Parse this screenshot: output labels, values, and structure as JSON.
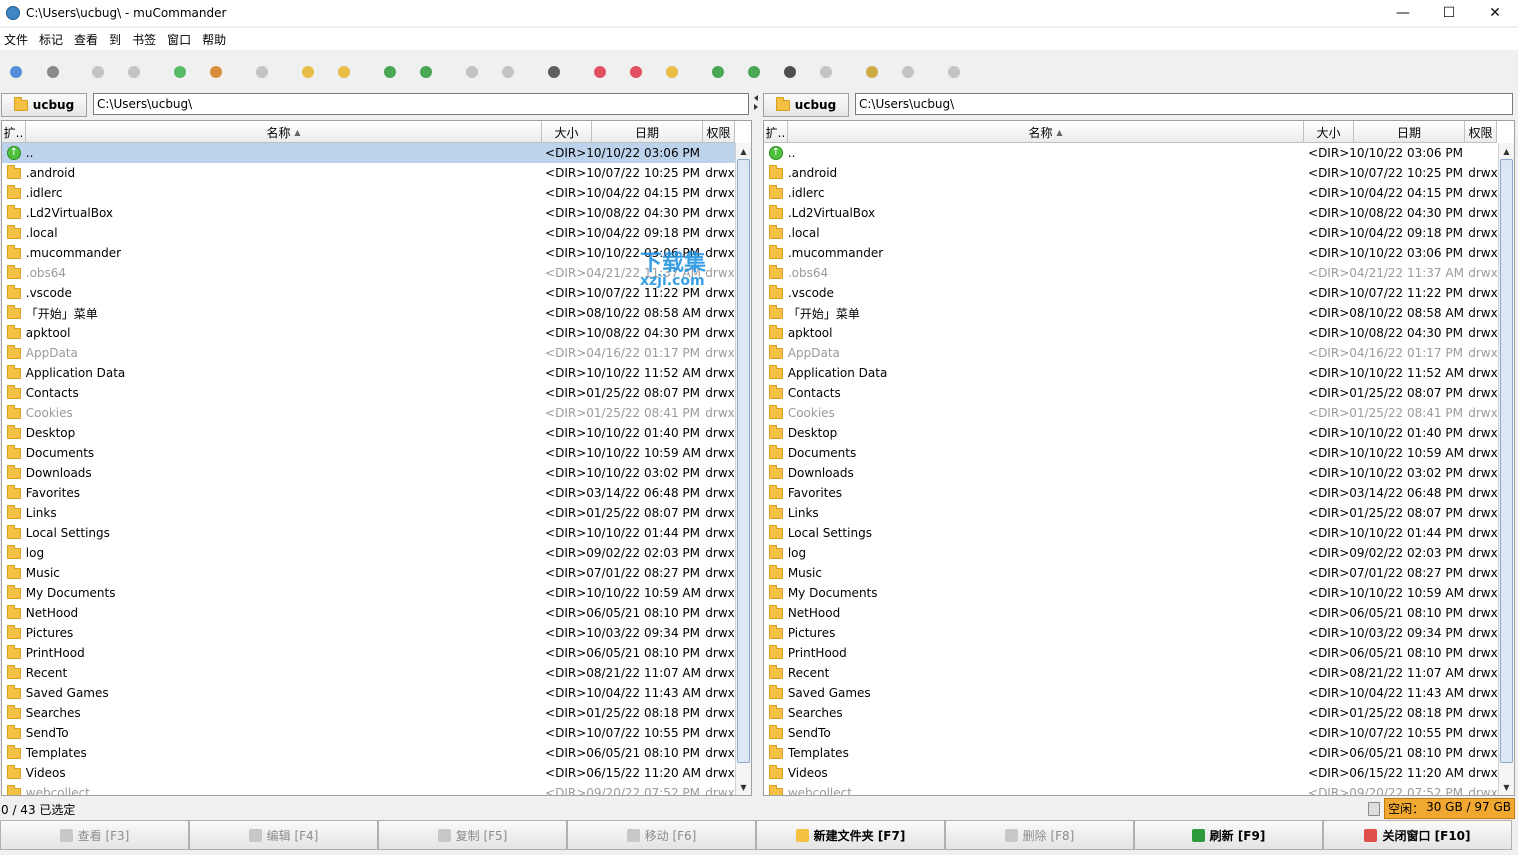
{
  "window": {
    "title": "C:\\Users\\ucbug\\ - muCommander"
  },
  "menu": [
    "文件",
    "标记",
    "查看",
    "到",
    "书签",
    "窗口",
    "帮助"
  ],
  "toolbar_icons": [
    "new-window-icon",
    "add-drive-icon",
    "back-icon",
    "forward-icon",
    "parent-folder-icon",
    "home-icon",
    "stop-icon",
    "new-folder-icon",
    "new-file-icon",
    "refresh-icon",
    "swap-panels-icon",
    "pack-icon",
    "unpack-icon",
    "compare-icon",
    "add-bookmark-icon",
    "edit-bookmarks-icon",
    "credentials-icon",
    "connect-server-icon",
    "browse-web-icon",
    "terminal-icon",
    "console-icon",
    "run-icon",
    "email-icon",
    "preferences-icon"
  ],
  "left": {
    "location_button": "ucbug",
    "path": "C:\\Users\\ucbug\\",
    "headers": {
      "ext": "扩..",
      "name": "名称",
      "size": "大小",
      "date": "日期",
      "perm": "权限"
    }
  },
  "right": {
    "location_button": "ucbug",
    "path": "C:\\Users\\ucbug\\",
    "headers": {
      "ext": "扩..",
      "name": "名称",
      "size": "大小",
      "date": "日期",
      "perm": "权限"
    }
  },
  "files_left": [
    {
      "name": "..",
      "size": "<DIR>",
      "date": "10/10/22 03:06 PM",
      "perm": "",
      "up": true,
      "sel": true
    },
    {
      "name": ".android",
      "size": "<DIR>",
      "date": "10/07/22 10:25 PM",
      "perm": "drwx"
    },
    {
      "name": ".idlerc",
      "size": "<DIR>",
      "date": "10/04/22 04:15 PM",
      "perm": "drwx"
    },
    {
      "name": ".Ld2VirtualBox",
      "size": "<DIR>",
      "date": "10/08/22 04:30 PM",
      "perm": "drwx"
    },
    {
      "name": ".local",
      "size": "<DIR>",
      "date": "10/04/22 09:18 PM",
      "perm": "drwx"
    },
    {
      "name": ".mucommander",
      "size": "<DIR>",
      "date": "10/10/22 03:06 PM",
      "perm": "drwx"
    },
    {
      "name": ".obs64",
      "size": "<DIR>",
      "date": "04/21/22 11:37 AM",
      "perm": "drwx",
      "hidden": true
    },
    {
      "name": ".vscode",
      "size": "<DIR>",
      "date": "10/07/22 11:22 PM",
      "perm": "drwx"
    },
    {
      "name": "「开始」菜单",
      "size": "<DIR>",
      "date": "08/10/22 08:58 AM",
      "perm": "drwx"
    },
    {
      "name": "apktool",
      "size": "<DIR>",
      "date": "10/08/22 04:30 PM",
      "perm": "drwx"
    },
    {
      "name": "AppData",
      "size": "<DIR>",
      "date": "04/16/22 01:17 PM",
      "perm": "drwx",
      "hidden": true
    },
    {
      "name": "Application Data",
      "size": "<DIR>",
      "date": "10/10/22 11:52 AM",
      "perm": "drwx"
    },
    {
      "name": "Contacts",
      "size": "<DIR>",
      "date": "01/25/22 08:07 PM",
      "perm": "drwx"
    },
    {
      "name": "Cookies",
      "size": "<DIR>",
      "date": "01/25/22 08:41 PM",
      "perm": "drwx",
      "hidden": true
    },
    {
      "name": "Desktop",
      "size": "<DIR>",
      "date": "10/10/22 01:40 PM",
      "perm": "drwx"
    },
    {
      "name": "Documents",
      "size": "<DIR>",
      "date": "10/10/22 10:59 AM",
      "perm": "drwx"
    },
    {
      "name": "Downloads",
      "size": "<DIR>",
      "date": "10/10/22 03:02 PM",
      "perm": "drwx"
    },
    {
      "name": "Favorites",
      "size": "<DIR>",
      "date": "03/14/22 06:48 PM",
      "perm": "drwx"
    },
    {
      "name": "Links",
      "size": "<DIR>",
      "date": "01/25/22 08:07 PM",
      "perm": "drwx"
    },
    {
      "name": "Local Settings",
      "size": "<DIR>",
      "date": "10/10/22 01:44 PM",
      "perm": "drwx"
    },
    {
      "name": "log",
      "size": "<DIR>",
      "date": "09/02/22 02:03 PM",
      "perm": "drwx"
    },
    {
      "name": "Music",
      "size": "<DIR>",
      "date": "07/01/22 08:27 PM",
      "perm": "drwx"
    },
    {
      "name": "My Documents",
      "size": "<DIR>",
      "date": "10/10/22 10:59 AM",
      "perm": "drwx"
    },
    {
      "name": "NetHood",
      "size": "<DIR>",
      "date": "06/05/21 08:10 PM",
      "perm": "drwx"
    },
    {
      "name": "Pictures",
      "size": "<DIR>",
      "date": "10/03/22 09:34 PM",
      "perm": "drwx"
    },
    {
      "name": "PrintHood",
      "size": "<DIR>",
      "date": "06/05/21 08:10 PM",
      "perm": "drwx"
    },
    {
      "name": "Recent",
      "size": "<DIR>",
      "date": "08/21/22 11:07 AM",
      "perm": "drwx"
    },
    {
      "name": "Saved Games",
      "size": "<DIR>",
      "date": "10/04/22 11:43 AM",
      "perm": "drwx"
    },
    {
      "name": "Searches",
      "size": "<DIR>",
      "date": "01/25/22 08:18 PM",
      "perm": "drwx"
    },
    {
      "name": "SendTo",
      "size": "<DIR>",
      "date": "10/07/22 10:55 PM",
      "perm": "drwx"
    },
    {
      "name": "Templates",
      "size": "<DIR>",
      "date": "06/05/21 08:10 PM",
      "perm": "drwx"
    },
    {
      "name": "Videos",
      "size": "<DIR>",
      "date": "06/15/22 11:20 AM",
      "perm": "drwx"
    },
    {
      "name": "webcollect",
      "size": "<DIR>",
      "date": "09/20/22 07:52 PM",
      "perm": "drwx",
      "hidden": true
    }
  ],
  "files_right": [
    {
      "name": "..",
      "size": "<DIR>",
      "date": "10/10/22 03:06 PM",
      "perm": "",
      "up": true
    },
    {
      "name": ".android",
      "size": "<DIR>",
      "date": "10/07/22 10:25 PM",
      "perm": "drwx"
    },
    {
      "name": ".idlerc",
      "size": "<DIR>",
      "date": "10/04/22 04:15 PM",
      "perm": "drwx"
    },
    {
      "name": ".Ld2VirtualBox",
      "size": "<DIR>",
      "date": "10/08/22 04:30 PM",
      "perm": "drwx"
    },
    {
      "name": ".local",
      "size": "<DIR>",
      "date": "10/04/22 09:18 PM",
      "perm": "drwx"
    },
    {
      "name": ".mucommander",
      "size": "<DIR>",
      "date": "10/10/22 03:06 PM",
      "perm": "drwx"
    },
    {
      "name": ".obs64",
      "size": "<DIR>",
      "date": "04/21/22 11:37 AM",
      "perm": "drwx",
      "hidden": true
    },
    {
      "name": ".vscode",
      "size": "<DIR>",
      "date": "10/07/22 11:22 PM",
      "perm": "drwx"
    },
    {
      "name": "「开始」菜单",
      "size": "<DIR>",
      "date": "08/10/22 08:58 AM",
      "perm": "drwx"
    },
    {
      "name": "apktool",
      "size": "<DIR>",
      "date": "10/08/22 04:30 PM",
      "perm": "drwx"
    },
    {
      "name": "AppData",
      "size": "<DIR>",
      "date": "04/16/22 01:17 PM",
      "perm": "drwx",
      "hidden": true
    },
    {
      "name": "Application Data",
      "size": "<DIR>",
      "date": "10/10/22 11:52 AM",
      "perm": "drwx"
    },
    {
      "name": "Contacts",
      "size": "<DIR>",
      "date": "01/25/22 08:07 PM",
      "perm": "drwx"
    },
    {
      "name": "Cookies",
      "size": "<DIR>",
      "date": "01/25/22 08:41 PM",
      "perm": "drwx",
      "hidden": true
    },
    {
      "name": "Desktop",
      "size": "<DIR>",
      "date": "10/10/22 01:40 PM",
      "perm": "drwx"
    },
    {
      "name": "Documents",
      "size": "<DIR>",
      "date": "10/10/22 10:59 AM",
      "perm": "drwx"
    },
    {
      "name": "Downloads",
      "size": "<DIR>",
      "date": "10/10/22 03:02 PM",
      "perm": "drwx"
    },
    {
      "name": "Favorites",
      "size": "<DIR>",
      "date": "03/14/22 06:48 PM",
      "perm": "drwx"
    },
    {
      "name": "Links",
      "size": "<DIR>",
      "date": "01/25/22 08:07 PM",
      "perm": "drwx"
    },
    {
      "name": "Local Settings",
      "size": "<DIR>",
      "date": "10/10/22 01:44 PM",
      "perm": "drwx"
    },
    {
      "name": "log",
      "size": "<DIR>",
      "date": "09/02/22 02:03 PM",
      "perm": "drwx"
    },
    {
      "name": "Music",
      "size": "<DIR>",
      "date": "07/01/22 08:27 PM",
      "perm": "drwx"
    },
    {
      "name": "My Documents",
      "size": "<DIR>",
      "date": "10/10/22 10:59 AM",
      "perm": "drwx"
    },
    {
      "name": "NetHood",
      "size": "<DIR>",
      "date": "06/05/21 08:10 PM",
      "perm": "drwx"
    },
    {
      "name": "Pictures",
      "size": "<DIR>",
      "date": "10/03/22 09:34 PM",
      "perm": "drwx"
    },
    {
      "name": "PrintHood",
      "size": "<DIR>",
      "date": "06/05/21 08:10 PM",
      "perm": "drwx"
    },
    {
      "name": "Recent",
      "size": "<DIR>",
      "date": "08/21/22 11:07 AM",
      "perm": "drwx"
    },
    {
      "name": "Saved Games",
      "size": "<DIR>",
      "date": "10/04/22 11:43 AM",
      "perm": "drwx"
    },
    {
      "name": "Searches",
      "size": "<DIR>",
      "date": "01/25/22 08:18 PM",
      "perm": "drwx"
    },
    {
      "name": "SendTo",
      "size": "<DIR>",
      "date": "10/07/22 10:55 PM",
      "perm": "drwx"
    },
    {
      "name": "Templates",
      "size": "<DIR>",
      "date": "06/05/21 08:10 PM",
      "perm": "drwx"
    },
    {
      "name": "Videos",
      "size": "<DIR>",
      "date": "06/15/22 11:20 AM",
      "perm": "drwx"
    },
    {
      "name": "webcollect",
      "size": "<DIR>",
      "date": "09/20/22 07:52 PM",
      "perm": "drwx",
      "hidden": true
    }
  ],
  "status": {
    "selection": "0 / 43 已选定",
    "free_label": "空闲：",
    "free_value": "30 GB / 97 GB"
  },
  "buttons": [
    {
      "label": "查看 [F3]",
      "icon": "view-icon",
      "enabled": false
    },
    {
      "label": "编辑 [F4]",
      "icon": "edit-icon",
      "enabled": false
    },
    {
      "label": "复制 [F5]",
      "icon": "copy-icon",
      "enabled": false
    },
    {
      "label": "移动 [F6]",
      "icon": "move-icon",
      "enabled": false
    },
    {
      "label": "新建文件夹 [F7]",
      "icon": "folder-icon",
      "enabled": true
    },
    {
      "label": "删除 [F8]",
      "icon": "delete-icon",
      "enabled": false
    },
    {
      "label": "刷新 [F9]",
      "icon": "refresh-icon",
      "enabled": true
    },
    {
      "label": "关闭窗口 [F10]",
      "icon": "close-window-icon",
      "enabled": true
    }
  ],
  "watermark": {
    "line1": "下载集",
    "line2": "xzji.com"
  },
  "colors": {
    "selection": "#bdd3ec",
    "hidden_text": "#9a9a9a",
    "free_space_bg": "#f0a830"
  }
}
